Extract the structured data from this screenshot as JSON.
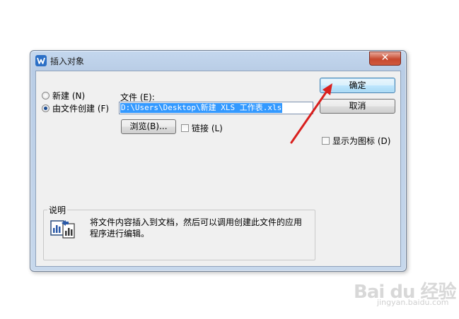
{
  "window": {
    "title": "插入对象",
    "close_glyph": "✕"
  },
  "options": {
    "new_label": "新建 (N)",
    "from_file_label": "由文件创建 (F)",
    "selected": "from_file"
  },
  "file": {
    "label": "文件 (E):",
    "value": "D:\\Users\\Desktop\\新建 XLS 工作表.xls"
  },
  "buttons": {
    "browse": "浏览(B)...",
    "ok": "确定",
    "cancel": "取消"
  },
  "checkboxes": {
    "link": "链接 (L)",
    "link_checked": false,
    "display_as_icon": "显示为图标 (D)",
    "display_as_icon_checked": false
  },
  "description": {
    "title": "说明",
    "line1": "将文件内容插入到文档，然后可以调用创建此文件的应用",
    "line2": "程序进行编辑。"
  },
  "annotation": {
    "arrow_color": "#d9201e"
  },
  "watermark": {
    "brand": "Bai du 经验",
    "url": "jingyan.baidu.com"
  }
}
